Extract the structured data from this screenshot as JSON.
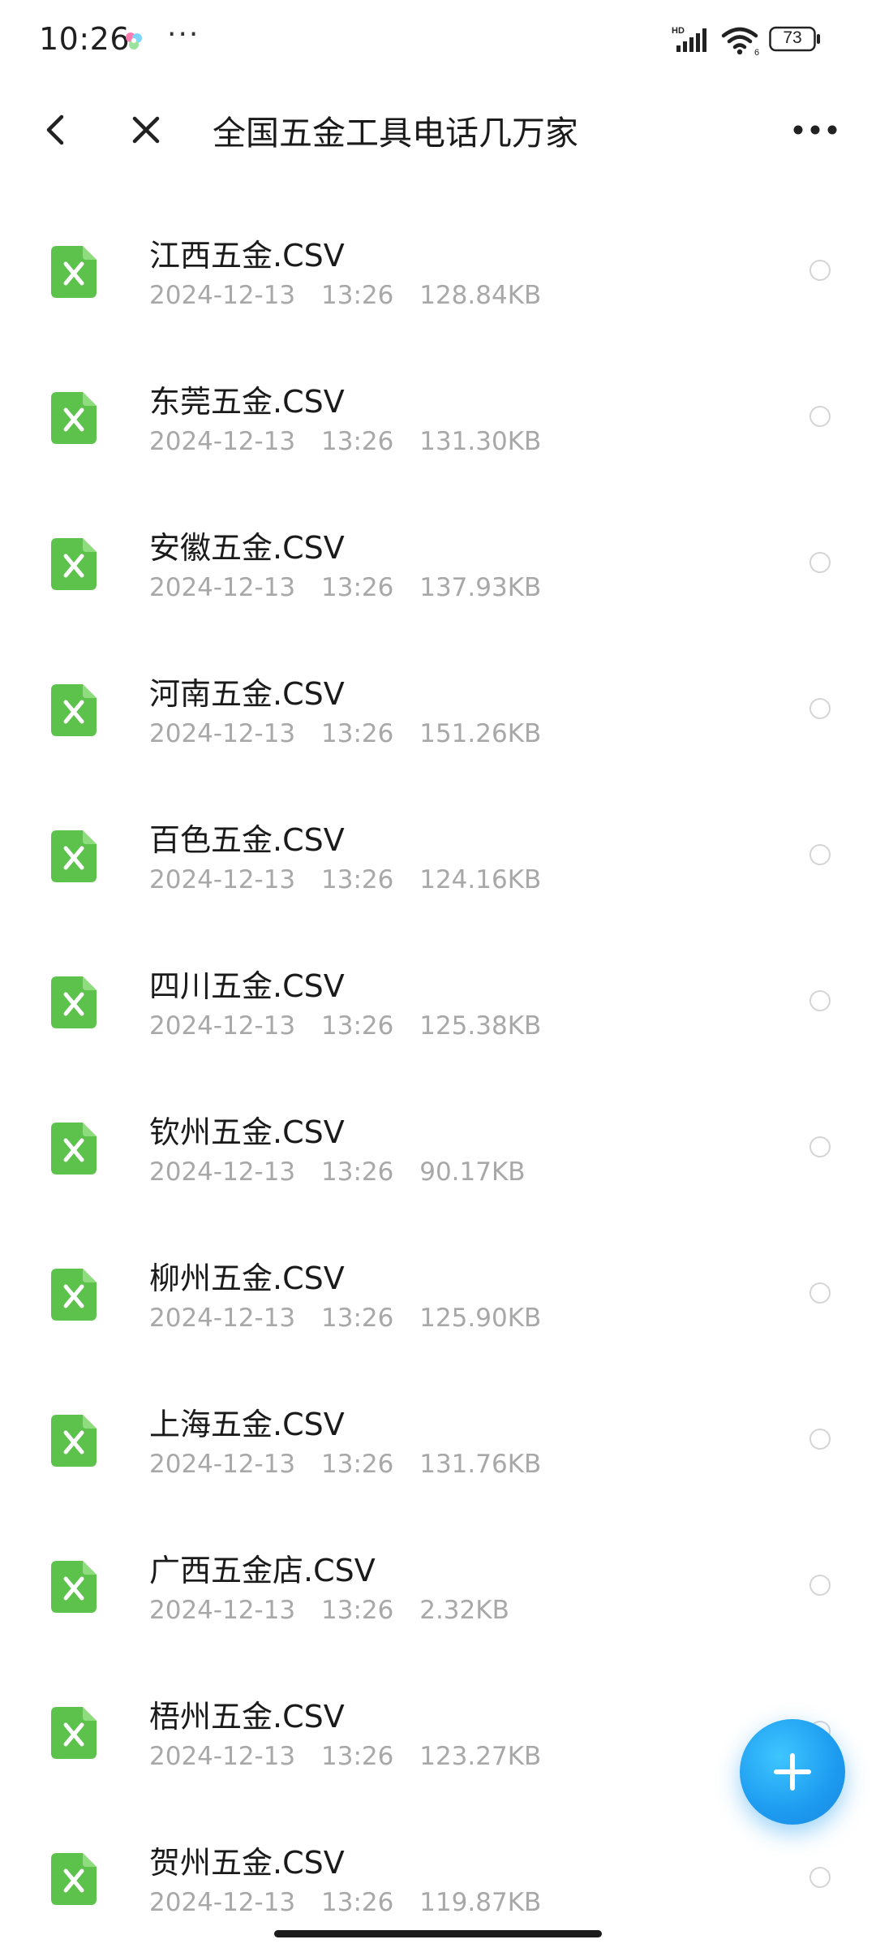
{
  "status_bar": {
    "time": "10:26",
    "more_indicator": "···",
    "network_label": "HD",
    "battery_level": "73",
    "icons": [
      "app-notification-icon",
      "signal-icon",
      "wifi-icon",
      "battery-icon"
    ]
  },
  "header": {
    "title": "全国五金工具电话几万家",
    "icons": [
      "back-arrow-icon",
      "close-icon",
      "more-dots-icon"
    ]
  },
  "files": [
    {
      "name": "江西五金.CSV",
      "date": "2024-12-13",
      "time": "13:26",
      "size": "128.84KB"
    },
    {
      "name": "东莞五金.CSV",
      "date": "2024-12-13",
      "time": "13:26",
      "size": "131.30KB"
    },
    {
      "name": "安徽五金.CSV",
      "date": "2024-12-13",
      "time": "13:26",
      "size": "137.93KB"
    },
    {
      "name": "河南五金.CSV",
      "date": "2024-12-13",
      "time": "13:26",
      "size": "151.26KB"
    },
    {
      "name": "百色五金.CSV",
      "date": "2024-12-13",
      "time": "13:26",
      "size": "124.16KB"
    },
    {
      "name": "四川五金.CSV",
      "date": "2024-12-13",
      "time": "13:26",
      "size": "125.38KB"
    },
    {
      "name": "钦州五金.CSV",
      "date": "2024-12-13",
      "time": "13:26",
      "size": "90.17KB"
    },
    {
      "name": "柳州五金.CSV",
      "date": "2024-12-13",
      "time": "13:26",
      "size": "125.90KB"
    },
    {
      "name": "上海五金.CSV",
      "date": "2024-12-13",
      "time": "13:26",
      "size": "131.76KB"
    },
    {
      "name": "广西五金店.CSV",
      "date": "2024-12-13",
      "time": "13:26",
      "size": "2.32KB"
    },
    {
      "name": "梧州五金.CSV",
      "date": "2024-12-13",
      "time": "13:26",
      "size": "123.27KB"
    },
    {
      "name": "贺州五金.CSV",
      "date": "2024-12-13",
      "time": "13:26",
      "size": "119.87KB"
    }
  ],
  "file_icon": "excel-file-icon",
  "fab_icon": "plus-icon",
  "colors": {
    "file_icon_green": "#5cc24c",
    "fab_blue": "#1d9bf0",
    "meta_gray": "#a8a8a8",
    "title_text": "#1a1a1a"
  }
}
